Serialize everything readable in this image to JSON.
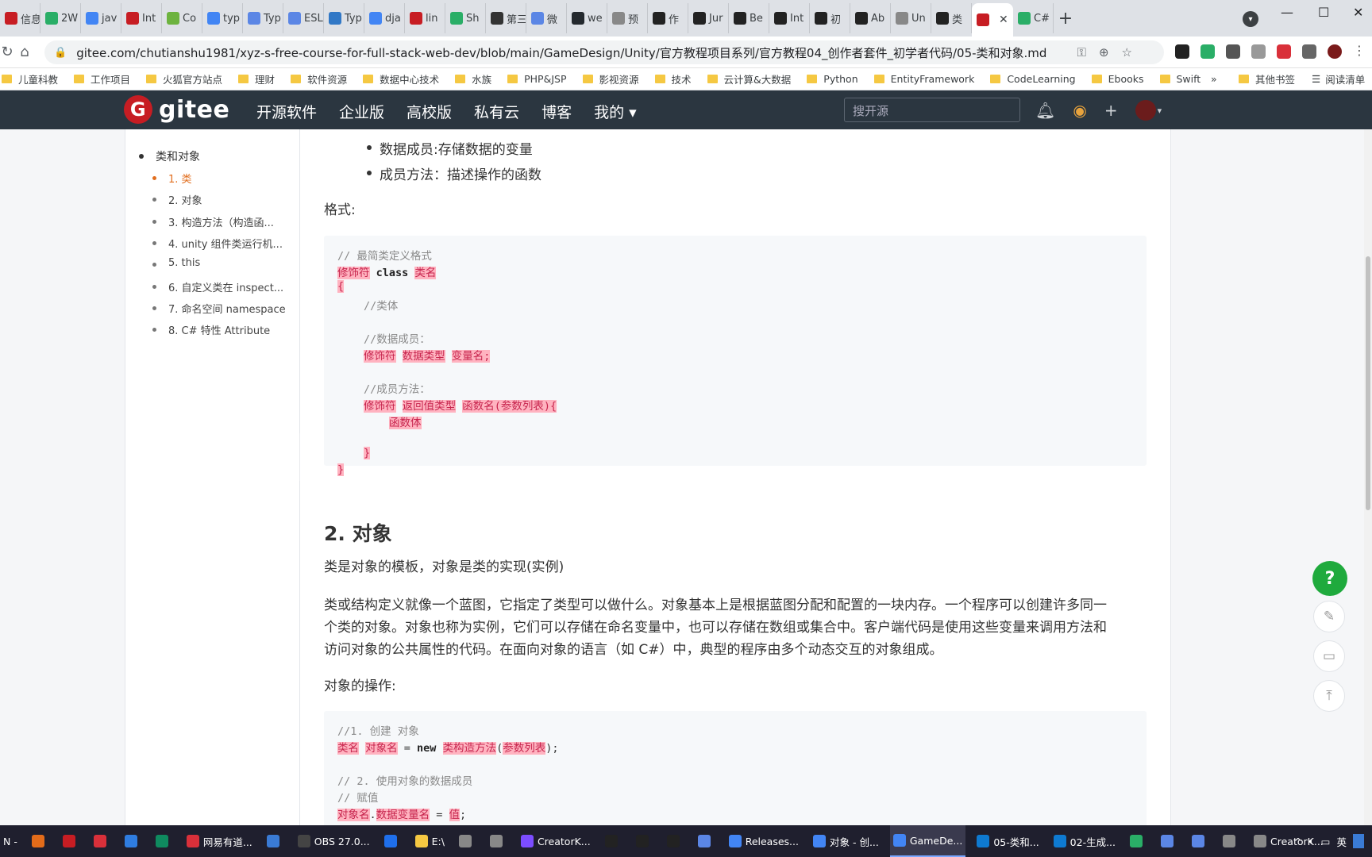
{
  "browser": {
    "tabs": [
      {
        "label": "信息",
        "color": "#c71d23"
      },
      {
        "label": "2W",
        "color": "#2aae67"
      },
      {
        "label": "jav",
        "color": "#4285f4"
      },
      {
        "label": "Int",
        "color": "#c71d23"
      },
      {
        "label": "Co",
        "color": "#6db33f"
      },
      {
        "label": "typ",
        "color": "#4285f4"
      },
      {
        "label": "Typ",
        "color": "#5b86e5"
      },
      {
        "label": "ESL",
        "color": "#5b86e5"
      },
      {
        "label": "Typ",
        "color": "#3178c6"
      },
      {
        "label": "dja",
        "color": "#4285f4"
      },
      {
        "label": "lin",
        "color": "#c71d23"
      },
      {
        "label": "Sh",
        "color": "#2aae67"
      },
      {
        "label": "第三",
        "color": "#333333"
      },
      {
        "label": "微",
        "color": "#5b86e5"
      },
      {
        "label": "we",
        "color": "#24292e"
      },
      {
        "label": "预",
        "color": "#888888"
      },
      {
        "label": "作",
        "color": "#222222"
      },
      {
        "label": "Jur",
        "color": "#222222"
      },
      {
        "label": "Be",
        "color": "#222222"
      },
      {
        "label": "Int",
        "color": "#222222"
      },
      {
        "label": "初",
        "color": "#222222"
      },
      {
        "label": "Ab",
        "color": "#222222"
      },
      {
        "label": "Un",
        "color": "#888888"
      },
      {
        "label": "类",
        "color": "#222222"
      },
      {
        "label": "",
        "color": "#c71d23",
        "active": true
      },
      {
        "label": "C#",
        "color": "#2aae67"
      }
    ],
    "url": "gitee.com/chutianshu1981/xyz-s-free-course-for-full-stack-web-dev/blob/main/GameDesign/Unity/官方教程项目系列/官方教程04_创作者套件_初学者代码/05-类和对象.md",
    "bookmarks": [
      "儿童科教",
      "工作项目",
      "火狐官方站点",
      "理财",
      "软件资源",
      "数据中心技术",
      "水族",
      "PHP&JSP",
      "影视资源",
      "技术",
      "云计算&大数据",
      "Python",
      "EntityFramework",
      "CodeLearning",
      "Ebooks",
      "Swift"
    ],
    "bookmarks_more": "»",
    "bookmarks_other": "其他书签",
    "bookmarks_reading": "阅读清单"
  },
  "gitee": {
    "logo_text": "gitee",
    "nav": [
      "开源软件",
      "企业版",
      "高校版",
      "私有云",
      "博客",
      "我的 ▾"
    ],
    "search_placeholder": "搜开源"
  },
  "toc": {
    "root": "类和对象",
    "items": [
      {
        "label": "1. 类",
        "active": true
      },
      {
        "label": "2. 对象"
      },
      {
        "label": "3. 构造方法（构造函..."
      },
      {
        "label": "4. unity 组件类运行机..."
      },
      {
        "label": "5. this"
      },
      {
        "label": "6. 自定义类在 inspect..."
      },
      {
        "label": "7. 命名空间 namespace"
      },
      {
        "label": "8. C# 特性 Attribute"
      }
    ]
  },
  "doc": {
    "bullets": [
      "数据成员:存储数据的变量",
      "成员方法：描述操作的函数"
    ],
    "format_label": "格式:",
    "code1": {
      "comment_min": "// 最简类定义格式",
      "modifier": "修饰符",
      "class_kw": "class",
      "class_name": "类名",
      "lbrace": "{",
      "rbrace": "}",
      "comment_body": "//类体",
      "comment_data": "//数据成员：",
      "data_type": "数据类型",
      "var_name": "变量名;",
      "comment_method": "//成员方法：",
      "return_type": "返回值类型",
      "func_sig": "函数名(参数列表){",
      "func_body": "函数体",
      "inner_rbrace": "}"
    },
    "h2_object": "2. 对象",
    "p1": "类是对象的模板，对象是类的实现(实例)",
    "p2_line1": "类或结构定义就像一个蓝图，它指定了类型可以做什么。对象基本上是根据蓝图分配和配置的一块内存。一个程序可以创建许多同一",
    "p2_line2": "个类的对象。对象也称为实例，它们可以存储在命名变量中，也可以存储在数组或集合中。客户端代码是使用这些变量来调用方法和",
    "p2_line3": "访问对象的公共属性的代码。在面向对象的语言（如 C#）中，典型的程序由多个动态交互的对象组成。",
    "ops_label": "对象的操作:",
    "code2": {
      "c1": "//1. 创建 对象",
      "class_name": "类名",
      "obj_name": "对象名",
      "eq": " = ",
      "new_kw": "new",
      "ctor": "类构造方法",
      "lparen": "(",
      "params": "参数列表",
      "rparen_semi": ");",
      "c2": "// 2. 使用对象的数据成员",
      "c3": "// 赋值",
      "obj_name2": "对象名",
      "dot": ".",
      "data_var": "数据变量名",
      "eq2": " = ",
      "value": "值",
      "semi": ";"
    }
  },
  "fab": {
    "help": "?"
  },
  "taskbar": {
    "items": [
      {
        "label": "N -",
        "color": "#333333"
      },
      {
        "label": "",
        "color": "#e36c1a"
      },
      {
        "label": "",
        "color": "#c71d23"
      },
      {
        "label": "",
        "color": "#d9303a"
      },
      {
        "label": "",
        "color": "#2f7de1"
      },
      {
        "label": "",
        "color": "#0f8a5f"
      },
      {
        "label": "网易有道...",
        "color": "#d9303a"
      },
      {
        "label": "",
        "color": "#3a7bd5"
      },
      {
        "label": "OBS 27.0...",
        "color": "#444444"
      },
      {
        "label": "",
        "color": "#1f6feb"
      },
      {
        "label": "E:\\",
        "color": "#f5c842"
      },
      {
        "label": "",
        "color": "#888888"
      },
      {
        "label": "",
        "color": "#888888"
      },
      {
        "label": "CreatorK...",
        "color": "#7c4dff"
      },
      {
        "label": "",
        "color": "#222222"
      },
      {
        "label": "",
        "color": "#222222"
      },
      {
        "label": "",
        "color": "#222222"
      },
      {
        "label": "",
        "color": "#5b86e5"
      },
      {
        "label": "Releases...",
        "color": "#4285f4"
      },
      {
        "label": "对象 - 创...",
        "color": "#4285f4"
      },
      {
        "label": "GameDe...",
        "color": "#4285f4",
        "active": true
      },
      {
        "label": "05-类和...",
        "color": "#0e7ad1"
      },
      {
        "label": "02-生成...",
        "color": "#0e7ad1"
      },
      {
        "label": "",
        "color": "#2aae67"
      },
      {
        "label": "",
        "color": "#5b86e5"
      },
      {
        "label": "",
        "color": "#5b86e5"
      },
      {
        "label": "",
        "color": "#888888"
      },
      {
        "label": "CreatorK...",
        "color": "#888888"
      }
    ],
    "tray_lang": "英"
  }
}
